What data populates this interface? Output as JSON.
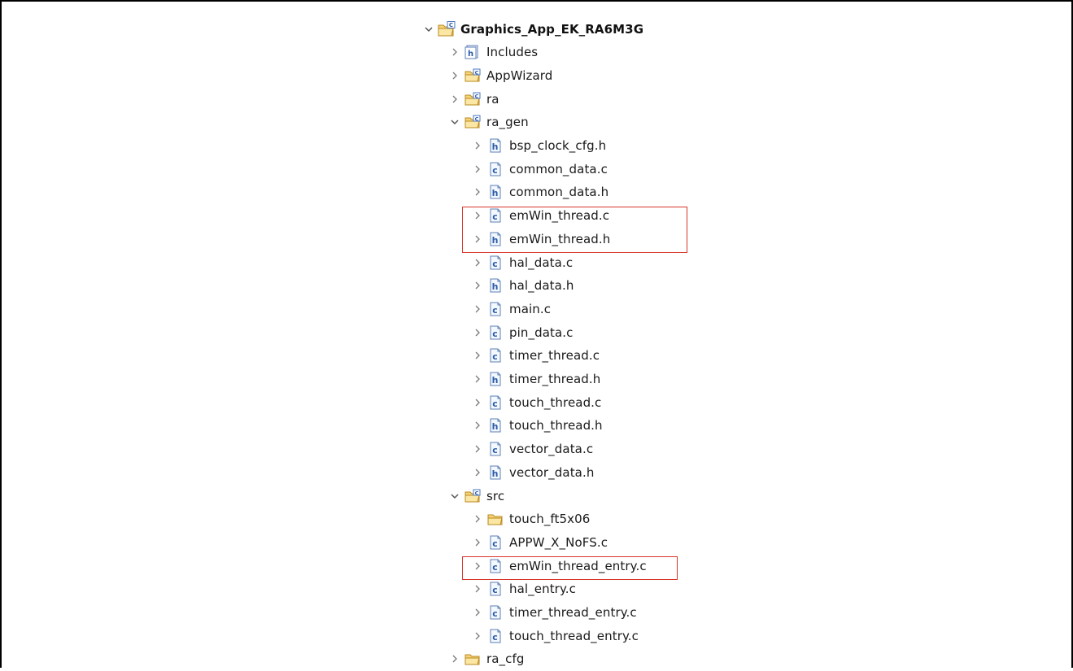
{
  "project": {
    "name": "Graphics_App_EK_RA6M3G",
    "highlight_color": "#d9362b",
    "items": [
      {
        "label": "Includes",
        "icon": "includes-icon",
        "state": "collapsed"
      },
      {
        "label": "AppWizard",
        "icon": "source-folder-icon",
        "state": "collapsed"
      },
      {
        "label": "ra",
        "icon": "source-folder-icon",
        "state": "collapsed"
      },
      {
        "label": "ra_gen",
        "icon": "source-folder-icon",
        "state": "expanded",
        "children": [
          {
            "label": "bsp_clock_cfg.h",
            "icon": "h-file-icon"
          },
          {
            "label": "common_data.c",
            "icon": "c-file-icon"
          },
          {
            "label": "common_data.h",
            "icon": "h-file-icon"
          },
          {
            "label": "emWin_thread.c",
            "icon": "c-file-icon",
            "highlighted": true
          },
          {
            "label": "emWin_thread.h",
            "icon": "h-file-icon",
            "highlighted": true
          },
          {
            "label": "hal_data.c",
            "icon": "c-file-icon"
          },
          {
            "label": "hal_data.h",
            "icon": "h-file-icon"
          },
          {
            "label": "main.c",
            "icon": "c-file-icon"
          },
          {
            "label": "pin_data.c",
            "icon": "c-file-icon"
          },
          {
            "label": "timer_thread.c",
            "icon": "c-file-icon"
          },
          {
            "label": "timer_thread.h",
            "icon": "h-file-icon"
          },
          {
            "label": "touch_thread.c",
            "icon": "c-file-icon"
          },
          {
            "label": "touch_thread.h",
            "icon": "h-file-icon"
          },
          {
            "label": "vector_data.c",
            "icon": "c-file-icon"
          },
          {
            "label": "vector_data.h",
            "icon": "h-file-icon"
          }
        ]
      },
      {
        "label": "src",
        "icon": "source-folder-icon",
        "state": "expanded",
        "children": [
          {
            "label": "touch_ft5x06",
            "icon": "folder-icon"
          },
          {
            "label": "APPW_X_NoFS.c",
            "icon": "c-file-icon"
          },
          {
            "label": "emWin_thread_entry.c",
            "icon": "c-file-icon",
            "highlighted": true
          },
          {
            "label": "hal_entry.c",
            "icon": "c-file-icon"
          },
          {
            "label": "timer_thread_entry.c",
            "icon": "c-file-icon"
          },
          {
            "label": "touch_thread_entry.c",
            "icon": "c-file-icon"
          }
        ]
      },
      {
        "label": "ra_cfg",
        "icon": "folder-icon",
        "state": "collapsed"
      }
    ]
  }
}
